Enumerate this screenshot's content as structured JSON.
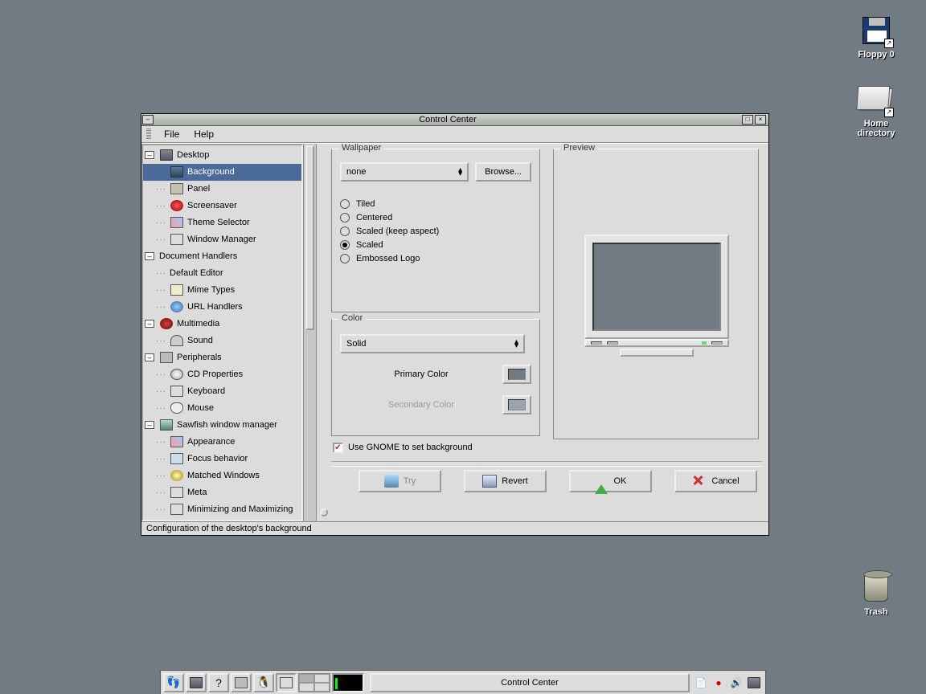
{
  "desktop_icons": {
    "floppy": "Floppy 0",
    "home": "Home directory",
    "trash": "Trash"
  },
  "window": {
    "title": "Control Center",
    "menu": {
      "file": "File",
      "help": "Help"
    },
    "status": "Configuration of the desktop's background"
  },
  "tree": {
    "desktop": "Desktop",
    "background": "Background",
    "panel": "Panel",
    "screensaver": "Screensaver",
    "theme": "Theme Selector",
    "wm": "Window Manager",
    "doch": "Document Handlers",
    "defed": "Default Editor",
    "mime": "Mime Types",
    "url": "URL Handlers",
    "mm": "Multimedia",
    "sound": "Sound",
    "periph": "Peripherals",
    "cd": "CD Properties",
    "kb": "Keyboard",
    "mouse": "Mouse",
    "saw": "Sawfish window manager",
    "appear": "Appearance",
    "focus": "Focus behavior",
    "matched": "Matched Windows",
    "meta": "Meta",
    "minmax": "Minimizing and Maximizing"
  },
  "wallpaper": {
    "legend": "Wallpaper",
    "combo": "none",
    "browse": "Browse...",
    "tiled": "Tiled",
    "centered": "Centered",
    "scaled_aspect": "Scaled (keep aspect)",
    "scaled": "Scaled",
    "embossed": "Embossed Logo"
  },
  "color": {
    "legend": "Color",
    "combo": "Solid",
    "primary": "Primary Color",
    "secondary": "Secondary Color",
    "primary_hex": "#717b84",
    "secondary_hex": "#9aa4ad"
  },
  "preview": {
    "legend": "Preview"
  },
  "checkbox": "Use GNOME to set background",
  "buttons": {
    "try": "Try",
    "revert": "Revert",
    "ok": "OK",
    "cancel": "Cancel"
  },
  "taskbar": {
    "task": "Control Center"
  }
}
